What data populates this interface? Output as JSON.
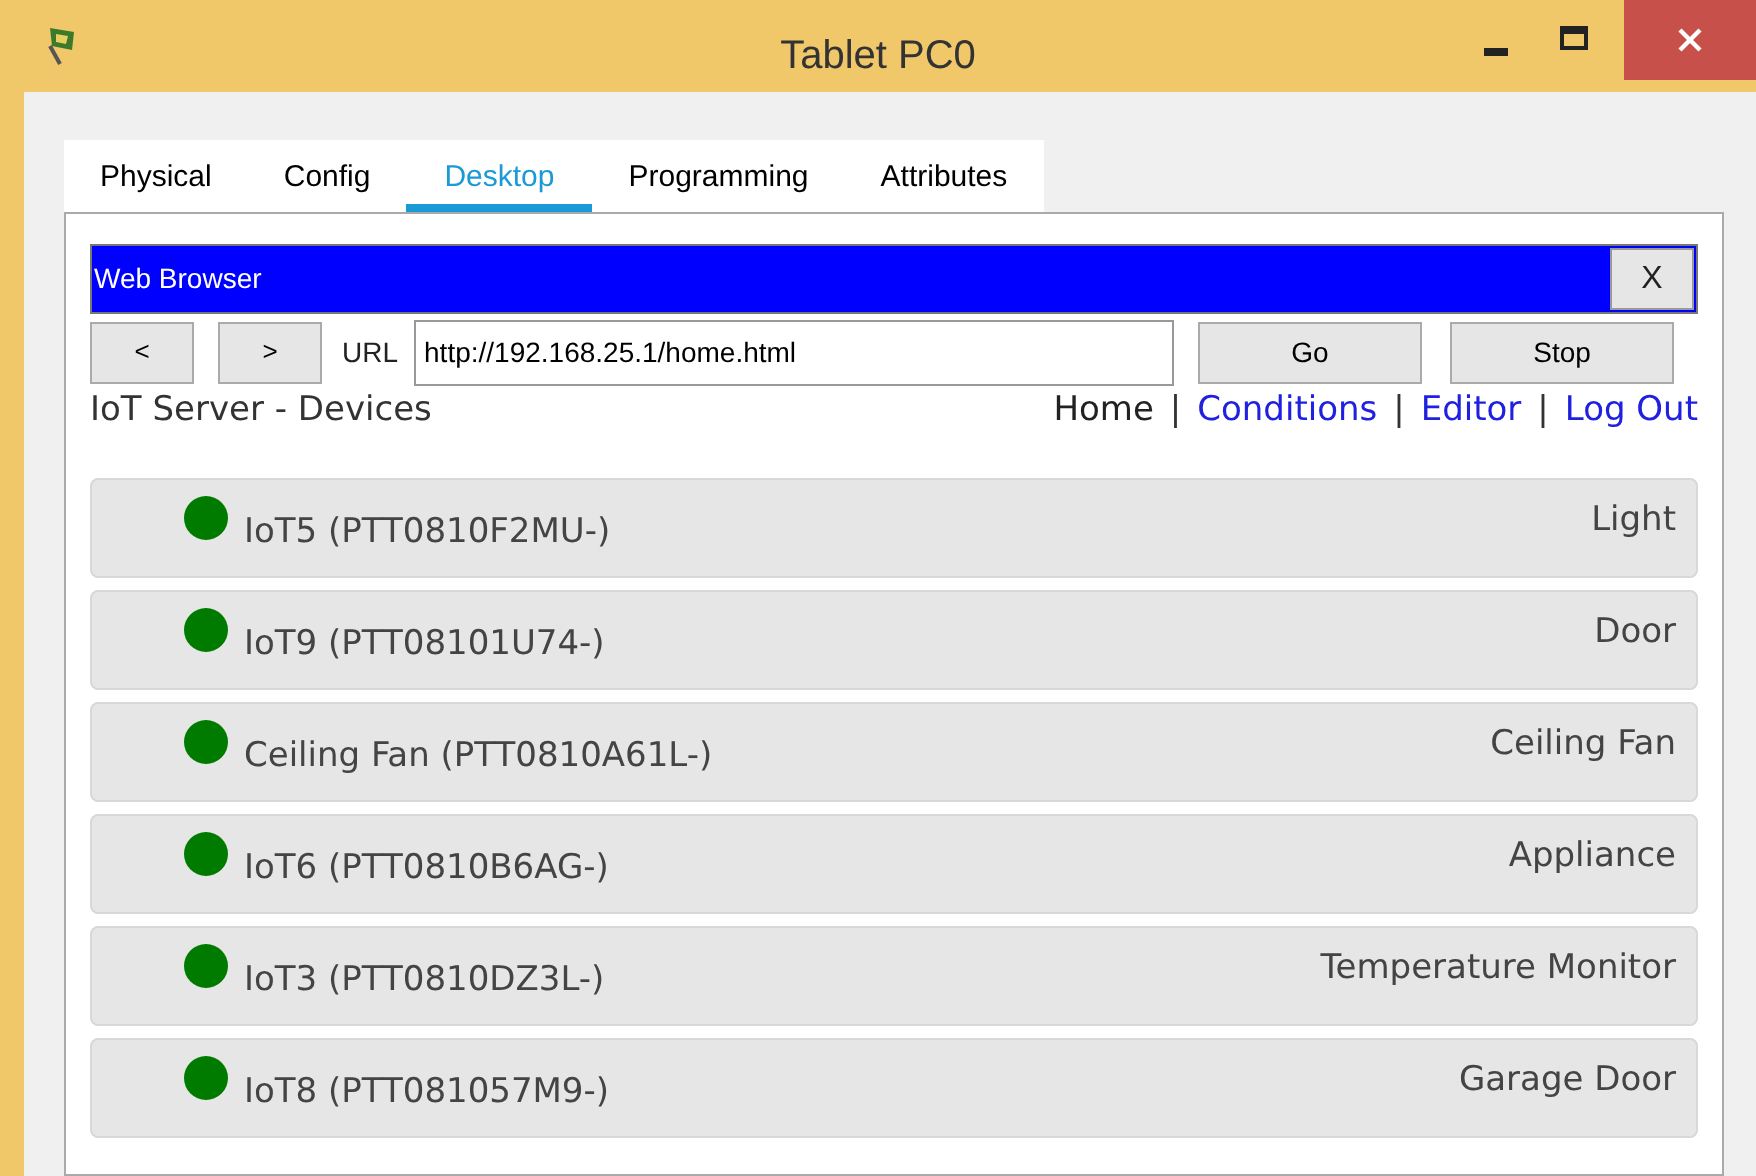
{
  "window": {
    "title": "Tablet PC0"
  },
  "tabs": [
    {
      "label": "Physical",
      "selected": false
    },
    {
      "label": "Config",
      "selected": false
    },
    {
      "label": "Desktop",
      "selected": true
    },
    {
      "label": "Programming",
      "selected": false
    },
    {
      "label": "Attributes",
      "selected": false
    }
  ],
  "browser": {
    "title": "Web Browser",
    "close": "X",
    "back": "<",
    "forward": ">",
    "url_label": "URL",
    "url": "http://192.168.25.1/home.html",
    "go": "Go",
    "stop": "Stop"
  },
  "page": {
    "heading": "IoT Server - Devices",
    "nav": [
      {
        "label": "Home",
        "kind": "current"
      },
      {
        "label": "Conditions",
        "kind": "link"
      },
      {
        "label": "Editor",
        "kind": "link"
      },
      {
        "label": "Log Out",
        "kind": "link"
      }
    ],
    "separator": "|"
  },
  "devices": [
    {
      "name": "IoT5 (PTT0810F2MU-)",
      "type": "Light",
      "color": "#007b00"
    },
    {
      "name": "IoT9 (PTT08101U74-)",
      "type": "Door",
      "color": "#007b00"
    },
    {
      "name": "Ceiling Fan (PTT0810A61L-)",
      "type": "Ceiling Fan",
      "color": "#007b00"
    },
    {
      "name": "IoT6 (PTT0810B6AG-)",
      "type": "Appliance",
      "color": "#007b00"
    },
    {
      "name": "IoT3 (PTT0810DZ3L-)",
      "type": "Temperature Monitor",
      "color": "#007b00"
    },
    {
      "name": "IoT8 (PTT081057M9-)",
      "type": "Garage Door",
      "color": "#007b00"
    }
  ]
}
